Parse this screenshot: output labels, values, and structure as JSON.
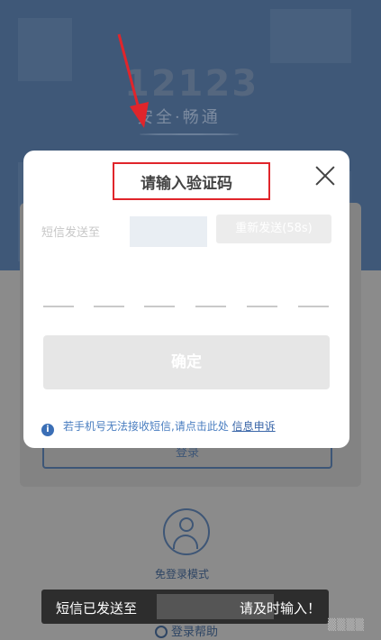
{
  "background": {
    "logo": "12123",
    "slogan": "安全·畅通",
    "login_button": "登录",
    "avatar_label": "免登录模式",
    "help_label": "登录帮助",
    "watermark": "▒▒▒▒"
  },
  "modal": {
    "title": "请输入验证码",
    "sms_label": "短信发送至",
    "resend_label": "重新发送(58s)",
    "confirm_label": "确定",
    "info_text": "若手机号无法接收短信,请点击此处",
    "info_link": "信息申诉",
    "code_slots": 6
  },
  "toast": {
    "left_text": "短信已发送至",
    "right_text": "请及时输入！"
  },
  "colors": {
    "accent": "#3b6fb6",
    "annotation": "#e0252b",
    "header_bg": "#3f5878"
  }
}
